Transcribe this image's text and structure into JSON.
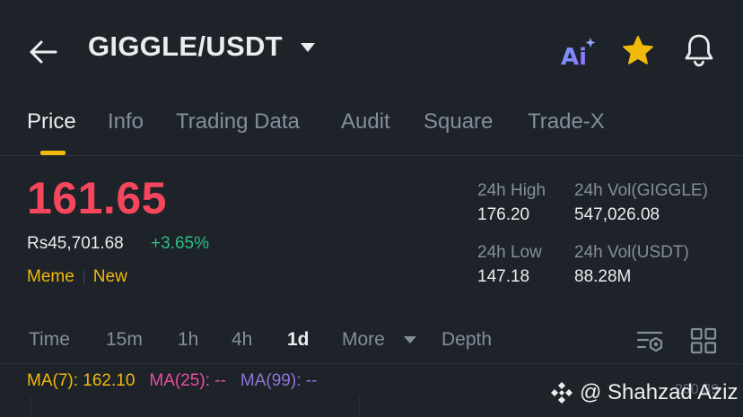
{
  "header": {
    "pair": "GIGGLE/USDT",
    "icons": [
      "back-arrow-icon",
      "chevron-down-icon",
      "ai-icon",
      "star-icon",
      "bell-icon"
    ],
    "ai_label": "Ai"
  },
  "tabs": [
    {
      "label": "Price",
      "active": true
    },
    {
      "label": "Info"
    },
    {
      "label": "Trading Data"
    },
    {
      "label": "Audit"
    },
    {
      "label": "Square"
    },
    {
      "label": "Trade-X"
    }
  ],
  "ticker": {
    "last_price": "161.65",
    "fiat_price": "Rs45,701.68",
    "change": "+3.65%",
    "tags": [
      "Meme",
      "New"
    ],
    "stats": [
      {
        "label": "24h High",
        "value": "176.20"
      },
      {
        "label": "24h Vol(GIGGLE)",
        "value": "547,026.08"
      },
      {
        "label": "24h Low",
        "value": "147.18"
      },
      {
        "label": "24h Vol(USDT)",
        "value": "88.28M"
      }
    ]
  },
  "timeframes": {
    "items": [
      "Time",
      "15m",
      "1h",
      "4h",
      "1d",
      "More",
      "Depth"
    ],
    "active": "1d"
  },
  "indicators": {
    "ma7": "MA(7): 162.10",
    "ma25": "MA(25): --",
    "ma99": "MA(99): --",
    "right_label": "200.39"
  },
  "watermark": "@ Shahzad Aziz",
  "colors": {
    "background": "#1e2329",
    "up": "#2ebd85",
    "down": "#f6465d",
    "accent": "#f0b90b"
  }
}
